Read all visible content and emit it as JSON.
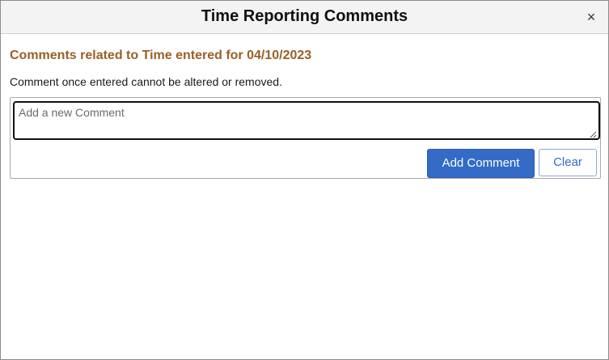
{
  "dialog": {
    "title": "Time Reporting Comments",
    "close_label": "×"
  },
  "content": {
    "heading": "Comments related to Time entered for 04/10/2023",
    "info": "Comment once entered cannot be altered or removed."
  },
  "comment_form": {
    "input_value": "",
    "placeholder": "Add a new Comment",
    "add_label": "Add Comment",
    "clear_label": "Clear"
  },
  "colors": {
    "heading": "#9a5f25",
    "primary_button": "#336bc6",
    "titlebar": "#f3f3f3"
  }
}
